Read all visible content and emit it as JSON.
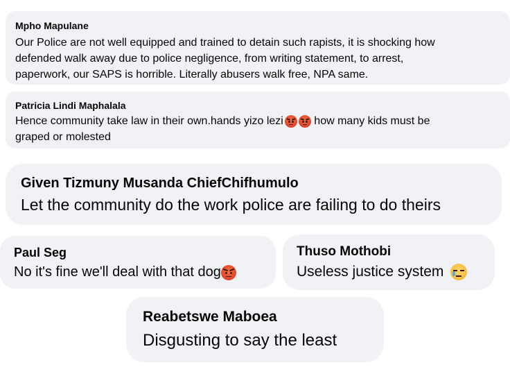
{
  "comments": [
    {
      "author": "Mpho Mapulane",
      "lines": [
        "Our Police are not well equipped and trained to detain such rapists, it is shocking how",
        "defended walk away due to police negligence, from writing statement, to arrest,",
        "paperwork, our SAPS is horrible. Literally abusers walk free, NPA same."
      ]
    },
    {
      "author": "Patricia Lindi Maphalala",
      "line1_before": "Hence community take law in their own.hands yizo lezi",
      "line1_after": " how many kids must be",
      "line2": "graped or molested",
      "emojis": [
        "angry-face-icon",
        "angry-face-icon"
      ]
    },
    {
      "author": "Given Tizmuny Musanda ChiefChifhumulo",
      "text": "Let the community do the work police are failing to do theirs"
    },
    {
      "author": "Paul Seg",
      "text": "No it's fine we'll deal with that dog",
      "emoji": "angry-face-icon"
    },
    {
      "author": "Thuso Mothobi",
      "text": "Useless justice system ",
      "emoji": "crying-face-icon"
    },
    {
      "author": "Reabetswe Maboea",
      "text": "Disgusting to say the least"
    }
  ],
  "colors": {
    "bubble": "#f0f2f5",
    "text": "#050505",
    "angry_emoji": "#e0432a",
    "sad_emoji": "#f7b733"
  }
}
